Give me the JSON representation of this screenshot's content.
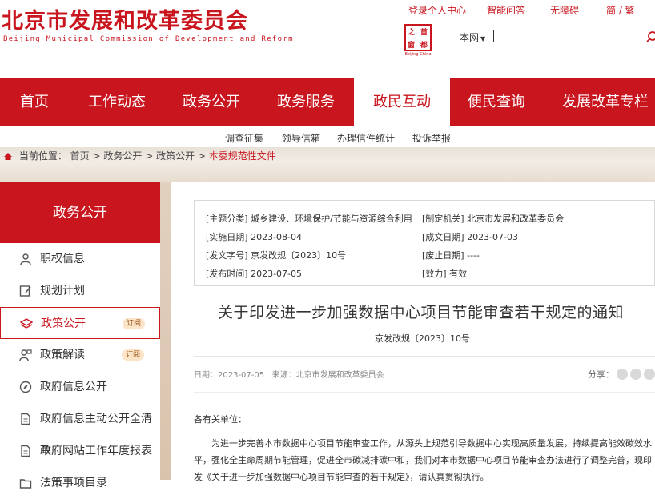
{
  "site": {
    "title_cn": "北京市发展和改革委员会",
    "title_en": "Beijing Municipal Commission of Development and Reform",
    "emblem_chars": [
      "之",
      "首",
      "窗",
      "都"
    ],
    "emblem_tag": "Beijing-China"
  },
  "toplinks": [
    "登录个人中心",
    "智能问答",
    "无障碍",
    "简 / 繁"
  ],
  "search": {
    "scope": "本网",
    "placeholder": ""
  },
  "nav": [
    "首页",
    "工作动态",
    "政务公开",
    "政务服务",
    "政民互动",
    "便民查询",
    "发展改革专栏"
  ],
  "subnav": [
    "调查征集",
    "领导信箱",
    "办理信件统计",
    "投诉举报"
  ],
  "breadcrumb": {
    "label": "当前位置：",
    "items": [
      "首页",
      "政务公开",
      "政策公开"
    ],
    "current": "本委规范性文件",
    "sep": " > "
  },
  "sidebar": {
    "heading": "政务公开",
    "items": [
      {
        "label": "职权信息",
        "icon": "person-icon"
      },
      {
        "label": "规划计划",
        "icon": "edit-icon"
      },
      {
        "label": "政策公开",
        "icon": "layers-icon",
        "badge": "订阅",
        "active": true
      },
      {
        "label": "政策解读",
        "icon": "person-chat-icon",
        "badge": "订阅"
      },
      {
        "label": "政府信息公开",
        "icon": "compass-icon"
      },
      {
        "label": "政府信息主动公开全清单",
        "icon": "document-icon"
      },
      {
        "label": "政府网站工作年度报表",
        "icon": "document-icon"
      },
      {
        "label": "法策事项目录",
        "icon": "folder-icon"
      }
    ]
  },
  "meta": {
    "topic_label": "[主题分类]",
    "topic": "城乡建设、环境保护/节能与资源综合利用",
    "org_label": "[制定机关]",
    "org": "北京市发展和改革委员会",
    "impl_label": "[实施日期]",
    "impl": "2023-08-04",
    "made_label": "[成文日期]",
    "made": "2023-07-03",
    "num_label": "[发文字号]",
    "num": "京发改规〔2023〕10号",
    "expire_label": "[废止日期]",
    "expire": "----",
    "pub_label": "[发布时间]",
    "pub": "2023-07-05",
    "valid_label": "[效力]",
    "valid": "有效"
  },
  "article": {
    "title": "关于印发进一步加强数据中心项目节能审查若干规定的通知",
    "docnum": "京发改规〔2023〕10号",
    "date_label": "日期：",
    "date": "2023-07-05",
    "source_label": "来源：",
    "source": "北京市发展和改革委员会",
    "share_label": "分享：",
    "greeting": "各有关单位：",
    "body": "为进一步完善本市数据中心项目节能审查工作，从源头上规范引导数据中心实现高质量发展，持续提高能效碳效水平，强化全生命周期节能管理，促进全市碳减排碳中和，我们对本市数据中心项目节能审查办法进行了调整完善，现印发《关于进一步加强数据中心项目节能审查的若干规定》，请认真贯彻执行。"
  },
  "colors": {
    "brand_red": "#c9151e",
    "badge_bg": "#fbe4c8"
  }
}
